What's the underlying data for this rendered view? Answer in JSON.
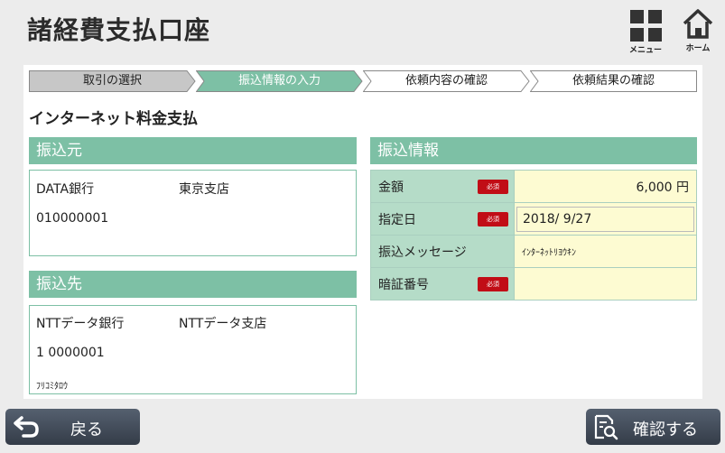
{
  "header": {
    "title": "諸経費支払口座",
    "menu_label": "メニュー",
    "home_label": "ホーム"
  },
  "steps": [
    {
      "label": "取引の選択",
      "state": "done"
    },
    {
      "label": "振込情報の入力",
      "state": "current"
    },
    {
      "label": "依頼内容の確認",
      "state": "todo"
    },
    {
      "label": "依頼結果の確認",
      "state": "todo"
    }
  ],
  "section_title": "インターネット料金支払",
  "from": {
    "heading": "振込元",
    "bank": "DATA銀行",
    "branch": "東京支店",
    "account": "010000001"
  },
  "to": {
    "heading": "振込先",
    "bank": "NTTデータ銀行",
    "branch": "NTTデータ支店",
    "account": "1 0000001",
    "name": "ﾌﾘｺﾐﾀﾛｳ"
  },
  "transfer": {
    "heading": "振込情報",
    "required_label": "必須",
    "amount_label": "金額",
    "amount_value": "6,000 円",
    "date_label": "指定日",
    "date_value": "2018/ 9/27",
    "message_label": "振込メッセージ",
    "message_value": "ｲﾝﾀｰﾈｯﾄﾘﾖｳｷﾝ",
    "pin_label": "暗証番号",
    "pin_value": ""
  },
  "buttons": {
    "back": "戻る",
    "confirm": "確認する"
  },
  "colors": {
    "accent": "#7dc0a5",
    "button": "#3f4755",
    "required": "#c10d16",
    "input_bg": "#fdfbd2"
  }
}
